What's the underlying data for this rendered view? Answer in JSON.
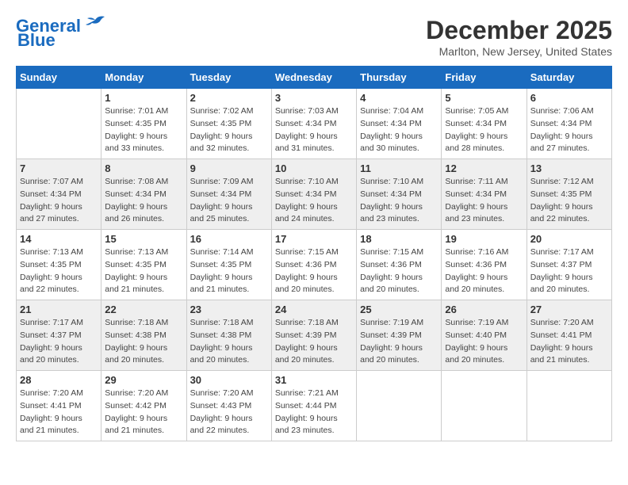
{
  "header": {
    "logo_line1": "General",
    "logo_line2": "Blue",
    "month": "December 2025",
    "location": "Marlton, New Jersey, United States"
  },
  "days_of_week": [
    "Sunday",
    "Monday",
    "Tuesday",
    "Wednesday",
    "Thursday",
    "Friday",
    "Saturday"
  ],
  "weeks": [
    [
      {
        "day": "",
        "sunrise": "",
        "sunset": "",
        "daylight": ""
      },
      {
        "day": "1",
        "sunrise": "Sunrise: 7:01 AM",
        "sunset": "Sunset: 4:35 PM",
        "daylight": "Daylight: 9 hours and 33 minutes."
      },
      {
        "day": "2",
        "sunrise": "Sunrise: 7:02 AM",
        "sunset": "Sunset: 4:35 PM",
        "daylight": "Daylight: 9 hours and 32 minutes."
      },
      {
        "day": "3",
        "sunrise": "Sunrise: 7:03 AM",
        "sunset": "Sunset: 4:34 PM",
        "daylight": "Daylight: 9 hours and 31 minutes."
      },
      {
        "day": "4",
        "sunrise": "Sunrise: 7:04 AM",
        "sunset": "Sunset: 4:34 PM",
        "daylight": "Daylight: 9 hours and 30 minutes."
      },
      {
        "day": "5",
        "sunrise": "Sunrise: 7:05 AM",
        "sunset": "Sunset: 4:34 PM",
        "daylight": "Daylight: 9 hours and 28 minutes."
      },
      {
        "day": "6",
        "sunrise": "Sunrise: 7:06 AM",
        "sunset": "Sunset: 4:34 PM",
        "daylight": "Daylight: 9 hours and 27 minutes."
      }
    ],
    [
      {
        "day": "7",
        "sunrise": "Sunrise: 7:07 AM",
        "sunset": "Sunset: 4:34 PM",
        "daylight": "Daylight: 9 hours and 27 minutes."
      },
      {
        "day": "8",
        "sunrise": "Sunrise: 7:08 AM",
        "sunset": "Sunset: 4:34 PM",
        "daylight": "Daylight: 9 hours and 26 minutes."
      },
      {
        "day": "9",
        "sunrise": "Sunrise: 7:09 AM",
        "sunset": "Sunset: 4:34 PM",
        "daylight": "Daylight: 9 hours and 25 minutes."
      },
      {
        "day": "10",
        "sunrise": "Sunrise: 7:10 AM",
        "sunset": "Sunset: 4:34 PM",
        "daylight": "Daylight: 9 hours and 24 minutes."
      },
      {
        "day": "11",
        "sunrise": "Sunrise: 7:10 AM",
        "sunset": "Sunset: 4:34 PM",
        "daylight": "Daylight: 9 hours and 23 minutes."
      },
      {
        "day": "12",
        "sunrise": "Sunrise: 7:11 AM",
        "sunset": "Sunset: 4:34 PM",
        "daylight": "Daylight: 9 hours and 23 minutes."
      },
      {
        "day": "13",
        "sunrise": "Sunrise: 7:12 AM",
        "sunset": "Sunset: 4:35 PM",
        "daylight": "Daylight: 9 hours and 22 minutes."
      }
    ],
    [
      {
        "day": "14",
        "sunrise": "Sunrise: 7:13 AM",
        "sunset": "Sunset: 4:35 PM",
        "daylight": "Daylight: 9 hours and 22 minutes."
      },
      {
        "day": "15",
        "sunrise": "Sunrise: 7:13 AM",
        "sunset": "Sunset: 4:35 PM",
        "daylight": "Daylight: 9 hours and 21 minutes."
      },
      {
        "day": "16",
        "sunrise": "Sunrise: 7:14 AM",
        "sunset": "Sunset: 4:35 PM",
        "daylight": "Daylight: 9 hours and 21 minutes."
      },
      {
        "day": "17",
        "sunrise": "Sunrise: 7:15 AM",
        "sunset": "Sunset: 4:36 PM",
        "daylight": "Daylight: 9 hours and 20 minutes."
      },
      {
        "day": "18",
        "sunrise": "Sunrise: 7:15 AM",
        "sunset": "Sunset: 4:36 PM",
        "daylight": "Daylight: 9 hours and 20 minutes."
      },
      {
        "day": "19",
        "sunrise": "Sunrise: 7:16 AM",
        "sunset": "Sunset: 4:36 PM",
        "daylight": "Daylight: 9 hours and 20 minutes."
      },
      {
        "day": "20",
        "sunrise": "Sunrise: 7:17 AM",
        "sunset": "Sunset: 4:37 PM",
        "daylight": "Daylight: 9 hours and 20 minutes."
      }
    ],
    [
      {
        "day": "21",
        "sunrise": "Sunrise: 7:17 AM",
        "sunset": "Sunset: 4:37 PM",
        "daylight": "Daylight: 9 hours and 20 minutes."
      },
      {
        "day": "22",
        "sunrise": "Sunrise: 7:18 AM",
        "sunset": "Sunset: 4:38 PM",
        "daylight": "Daylight: 9 hours and 20 minutes."
      },
      {
        "day": "23",
        "sunrise": "Sunrise: 7:18 AM",
        "sunset": "Sunset: 4:38 PM",
        "daylight": "Daylight: 9 hours and 20 minutes."
      },
      {
        "day": "24",
        "sunrise": "Sunrise: 7:18 AM",
        "sunset": "Sunset: 4:39 PM",
        "daylight": "Daylight: 9 hours and 20 minutes."
      },
      {
        "day": "25",
        "sunrise": "Sunrise: 7:19 AM",
        "sunset": "Sunset: 4:39 PM",
        "daylight": "Daylight: 9 hours and 20 minutes."
      },
      {
        "day": "26",
        "sunrise": "Sunrise: 7:19 AM",
        "sunset": "Sunset: 4:40 PM",
        "daylight": "Daylight: 9 hours and 20 minutes."
      },
      {
        "day": "27",
        "sunrise": "Sunrise: 7:20 AM",
        "sunset": "Sunset: 4:41 PM",
        "daylight": "Daylight: 9 hours and 21 minutes."
      }
    ],
    [
      {
        "day": "28",
        "sunrise": "Sunrise: 7:20 AM",
        "sunset": "Sunset: 4:41 PM",
        "daylight": "Daylight: 9 hours and 21 minutes."
      },
      {
        "day": "29",
        "sunrise": "Sunrise: 7:20 AM",
        "sunset": "Sunset: 4:42 PM",
        "daylight": "Daylight: 9 hours and 21 minutes."
      },
      {
        "day": "30",
        "sunrise": "Sunrise: 7:20 AM",
        "sunset": "Sunset: 4:43 PM",
        "daylight": "Daylight: 9 hours and 22 minutes."
      },
      {
        "day": "31",
        "sunrise": "Sunrise: 7:21 AM",
        "sunset": "Sunset: 4:44 PM",
        "daylight": "Daylight: 9 hours and 23 minutes."
      },
      {
        "day": "",
        "sunrise": "",
        "sunset": "",
        "daylight": ""
      },
      {
        "day": "",
        "sunrise": "",
        "sunset": "",
        "daylight": ""
      },
      {
        "day": "",
        "sunrise": "",
        "sunset": "",
        "daylight": ""
      }
    ]
  ]
}
